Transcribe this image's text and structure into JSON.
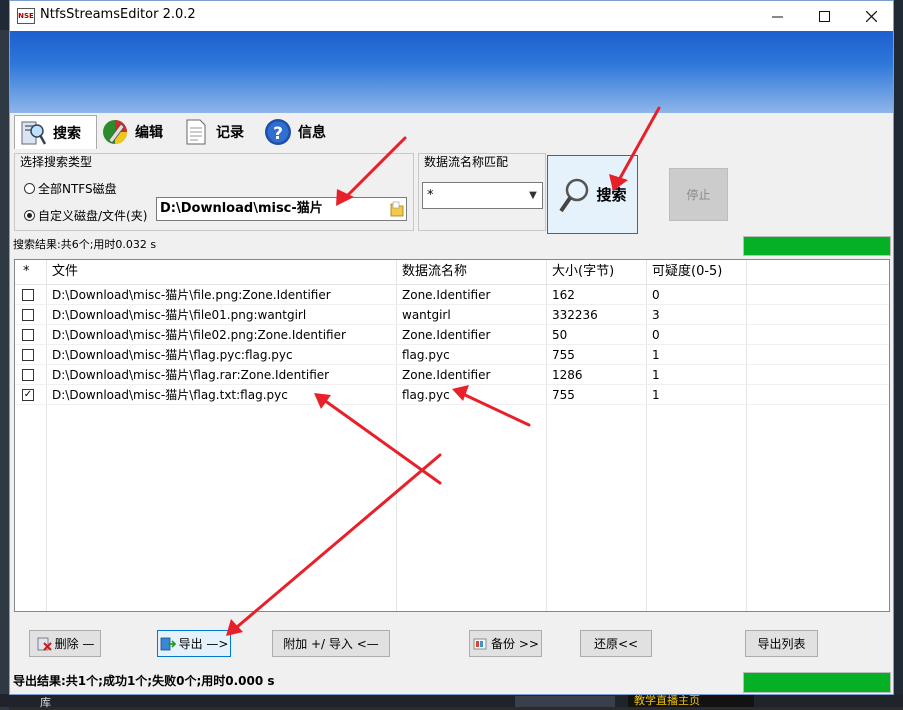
{
  "window": {
    "title": "NtfsStreamsEditor 2.0.2",
    "icon_text": "NSE"
  },
  "tabs": [
    {
      "label": "搜索",
      "icon": "search-tab-icon",
      "active": true
    },
    {
      "label": "编辑",
      "icon": "edit-tab-icon",
      "active": false
    },
    {
      "label": "记录",
      "icon": "log-tab-icon",
      "active": false
    },
    {
      "label": "信息",
      "icon": "info-tab-icon",
      "active": false
    }
  ],
  "search_type": {
    "group_label": "选择搜索类型",
    "option_all": "全部NTFS磁盘",
    "option_custom": "自定义磁盘/文件(夹)",
    "selected": "custom",
    "path_value": "D:\\Download\\misc-猫片"
  },
  "stream_match": {
    "label": "数据流名称匹配",
    "value": "*"
  },
  "buttons": {
    "search": "搜索",
    "stop": "停止",
    "delete": "删除 —",
    "export": "导出 —>",
    "append_import": "附加 +/ 导入 <—",
    "backup": "备份 >>",
    "restore": "还原<<",
    "export_list": "导出列表"
  },
  "search_status": {
    "text": "搜索结果:共6个;用时0.032 s",
    "progress": 1.0
  },
  "table": {
    "headers": [
      "*",
      "文件",
      "数据流名称",
      "大小(字节)",
      "可疑度(0-5)"
    ],
    "rows": [
      {
        "checked": false,
        "file": "D:\\Download\\misc-猫片\\file.png:Zone.Identifier",
        "stream": "Zone.Identifier",
        "size": "162",
        "suspicion": "0"
      },
      {
        "checked": false,
        "file": "D:\\Download\\misc-猫片\\file01.png:wantgirl",
        "stream": "wantgirl",
        "size": "332236",
        "suspicion": "3"
      },
      {
        "checked": false,
        "file": "D:\\Download\\misc-猫片\\file02.png:Zone.Identifier",
        "stream": "Zone.Identifier",
        "size": "50",
        "suspicion": "0"
      },
      {
        "checked": false,
        "file": "D:\\Download\\misc-猫片\\flag.pyc:flag.pyc",
        "stream": "flag.pyc",
        "size": "755",
        "suspicion": "1"
      },
      {
        "checked": false,
        "file": "D:\\Download\\misc-猫片\\flag.rar:Zone.Identifier",
        "stream": "Zone.Identifier",
        "size": "1286",
        "suspicion": "1"
      },
      {
        "checked": true,
        "file": "D:\\Download\\misc-猫片\\flag.txt:flag.pyc",
        "stream": "flag.pyc",
        "size": "755",
        "suspicion": "1"
      }
    ]
  },
  "export_status": {
    "text": "导出结果:共1个;成功1个;失败0个;用时0.000 s",
    "progress": 1.0
  },
  "taskbar": {
    "left_text": "库",
    "ad_text": "教学直播主页"
  },
  "colors": {
    "progress": "#06b025",
    "banner": "#2e77d9",
    "annotation": "#e8202a",
    "focus": "#0078d7"
  }
}
